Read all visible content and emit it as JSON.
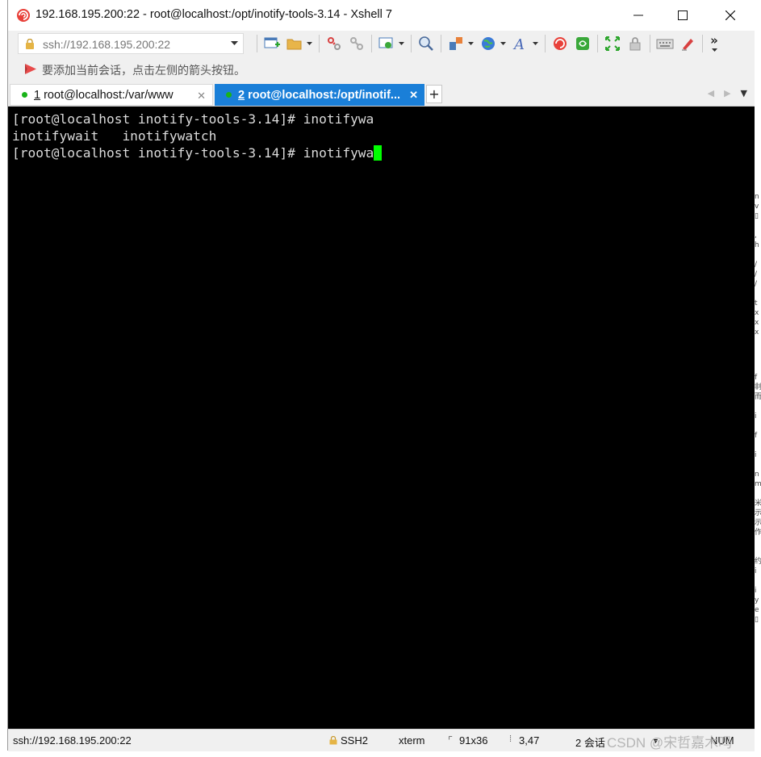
{
  "window": {
    "title": "192.168.195.200:22 - root@localhost:/opt/inotify-tools-3.14 - Xshell 7",
    "minimize_glyph": "—",
    "maximize_glyph": "☐",
    "close_glyph": "✕"
  },
  "toolbar": {
    "address": "ssh://192.168.195.200:22",
    "icons": [
      "new-session-icon",
      "open-folder-icon",
      "disconnect-icon",
      "reconnect-icon",
      "session-properties-icon",
      "find-icon",
      "transfer-icon",
      "globe-icon",
      "font-icon",
      "xshell-logo-icon",
      "xftp-icon",
      "fullscreen-icon",
      "lock-icon",
      "keyboard-icon",
      "highlight-icon"
    ],
    "overflow": "»"
  },
  "hint": {
    "text": "要添加当前会话，点击左侧的箭头按钮。"
  },
  "tabs": [
    {
      "number": "1",
      "label": "root@localhost:/var/www",
      "active": false
    },
    {
      "number": "2",
      "label": "root@localhost:/opt/inotif...",
      "active": true
    }
  ],
  "tab_add": "+",
  "terminal": {
    "lines": [
      "[root@localhost inotify-tools-3.14]# inotifywa",
      "inotifywait   inotifywatch",
      "[root@localhost inotify-tools-3.14]# inotifywa"
    ],
    "cursor_color": "#00ff00",
    "background": "#000000"
  },
  "status": {
    "connection": "ssh://192.168.195.200:22",
    "protocol": "SSH2",
    "term": "xterm",
    "size": "91x36",
    "cursor_pos": "3,47",
    "sessions": "2 会话",
    "num": "NUM"
  },
  "watermark": "CSDN @宋哲嘉木吗",
  "colors": {
    "active_tab": "#1a7fd8",
    "status_dot": "#19b319"
  }
}
